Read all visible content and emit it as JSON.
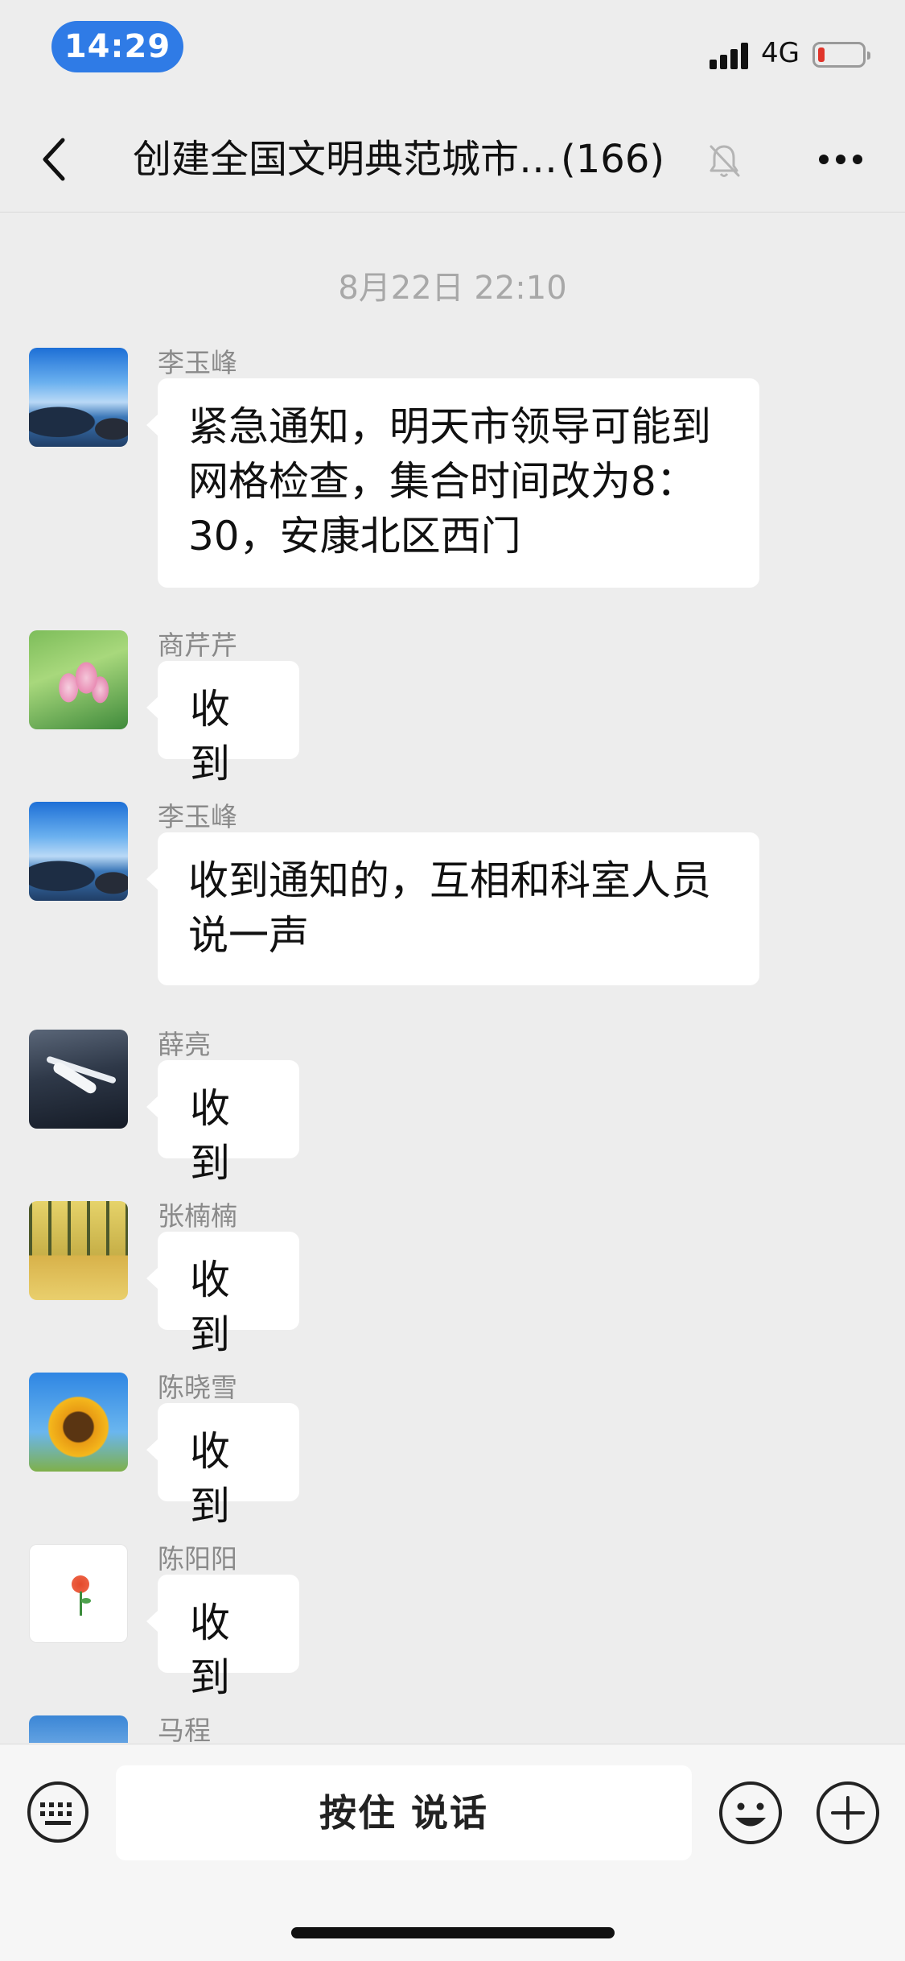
{
  "status_bar": {
    "time": "14:29",
    "network": "4G",
    "battery_level": 0.15
  },
  "nav": {
    "title": "创建全国文明典范城市…",
    "member_count": "(166)",
    "back_icon": "chevron-left-icon",
    "mute_icon": "bell-off-icon",
    "more_icon": "more-dots-icon"
  },
  "chat": {
    "timestamp": "8月22日 22:10",
    "messages": [
      {
        "sender": "李玉峰",
        "text": "紧急通知，明天市领导可能到网格检查，集合时间改为8：30，安康北区西门",
        "avatar": "seascape-avatar"
      },
      {
        "sender": "商芹芹",
        "text": "收到",
        "avatar": "lotus-avatar"
      },
      {
        "sender": "李玉峰",
        "text": "收到通知的，互相和科室人员说一声",
        "avatar": "seascape-avatar"
      },
      {
        "sender": "薛亮",
        "text": "收到",
        "avatar": "airplane-avatar"
      },
      {
        "sender": "张楠楠",
        "text": "收到",
        "avatar": "ginkgo-avatar"
      },
      {
        "sender": "陈晓雪",
        "text": "收到",
        "avatar": "sunflower-avatar"
      },
      {
        "sender": "陈阳阳",
        "text": "收到",
        "avatar": "rose-avatar"
      },
      {
        "sender": "马程",
        "text": "",
        "avatar": "sky-avatar"
      }
    ]
  },
  "input_bar": {
    "hold_to_talk": "按住 说话",
    "keyboard_icon": "keyboard-icon",
    "emoji_icon": "emoji-icon",
    "plus_icon": "plus-icon"
  },
  "colors": {
    "background": "#ededed",
    "bubble": "#ffffff",
    "time_pill": "#2f7be6",
    "battery_low": "#e0352b"
  }
}
